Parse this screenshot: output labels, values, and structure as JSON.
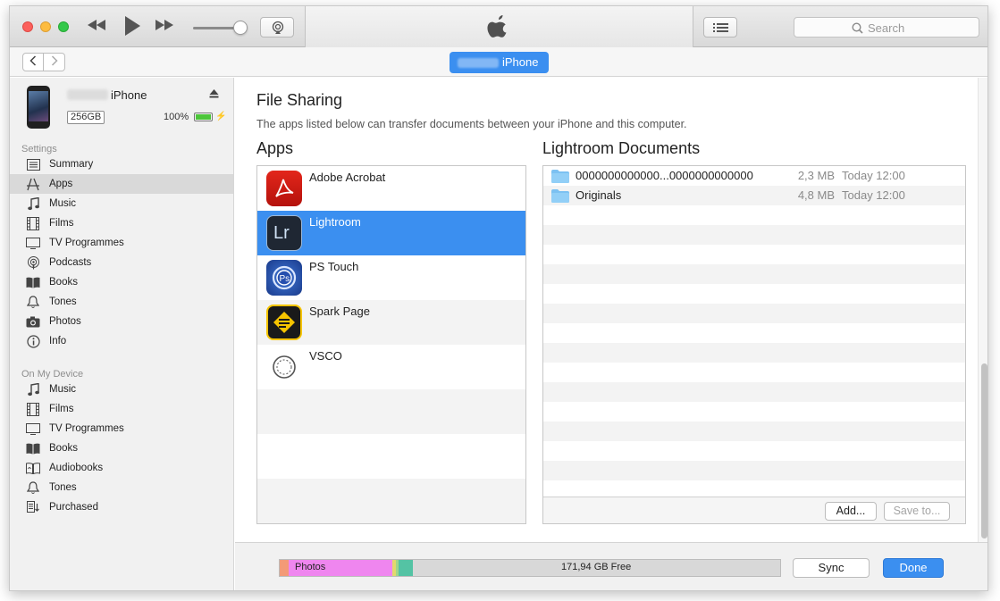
{
  "toolbar": {
    "search_placeholder": "Search",
    "icons": [
      "rewind-icon",
      "play-icon",
      "fast-forward-icon",
      "airplay-icon",
      "apple-logo",
      "list-icon",
      "search-icon"
    ]
  },
  "navbar": {
    "device_label": "iPhone"
  },
  "device": {
    "name": "iPhone",
    "capacity": "256GB",
    "battery": "100%",
    "battery_level": 1.0
  },
  "sidebar": {
    "settings_label": "Settings",
    "settings_items": [
      {
        "label": "Summary",
        "icon": "summary-icon"
      },
      {
        "label": "Apps",
        "icon": "apps-icon",
        "selected": true
      },
      {
        "label": "Music",
        "icon": "music-icon"
      },
      {
        "label": "Films",
        "icon": "films-icon"
      },
      {
        "label": "TV Programmes",
        "icon": "tv-icon"
      },
      {
        "label": "Podcasts",
        "icon": "podcasts-icon"
      },
      {
        "label": "Books",
        "icon": "books-icon"
      },
      {
        "label": "Tones",
        "icon": "tones-icon"
      },
      {
        "label": "Photos",
        "icon": "photos-icon"
      },
      {
        "label": "Info",
        "icon": "info-icon"
      }
    ],
    "device_label": "On My Device",
    "device_items": [
      {
        "label": "Music",
        "icon": "music-icon"
      },
      {
        "label": "Films",
        "icon": "films-icon"
      },
      {
        "label": "TV Programmes",
        "icon": "tv-icon"
      },
      {
        "label": "Books",
        "icon": "books-icon"
      },
      {
        "label": "Audiobooks",
        "icon": "audiobooks-icon"
      },
      {
        "label": "Tones",
        "icon": "tones-icon"
      },
      {
        "label": "Purchased",
        "icon": "purchased-icon"
      }
    ]
  },
  "main": {
    "title": "File Sharing",
    "description": "The apps listed below can transfer documents between your iPhone and this computer.",
    "apps_heading": "Apps",
    "docs_heading": "Lightroom Documents",
    "apps": [
      {
        "name": "Adobe Acrobat",
        "icon": "adobe-acrobat-icon"
      },
      {
        "name": "Lightroom",
        "icon": "lightroom-icon",
        "selected": true
      },
      {
        "name": "PS Touch",
        "icon": "ps-touch-icon"
      },
      {
        "name": "Spark Page",
        "icon": "spark-page-icon"
      },
      {
        "name": "VSCO",
        "icon": "vsco-icon"
      }
    ],
    "documents": [
      {
        "name": "0000000000000...0000000000000",
        "size": "2,3 MB",
        "date": "Today 12:00"
      },
      {
        "name": "Originals",
        "size": "4,8 MB",
        "date": "Today 12:00"
      }
    ],
    "add_button": "Add...",
    "save_button": "Save to..."
  },
  "footer": {
    "photos_label": "Photos",
    "free_label": "171,94 GB Free",
    "sync_button": "Sync",
    "done_button": "Done"
  },
  "colors": {
    "accent": "#3b8ff0",
    "photos_segment": "#ef86ef",
    "apps_segment": "#f39a77",
    "other_segment": "#54c3a4"
  }
}
